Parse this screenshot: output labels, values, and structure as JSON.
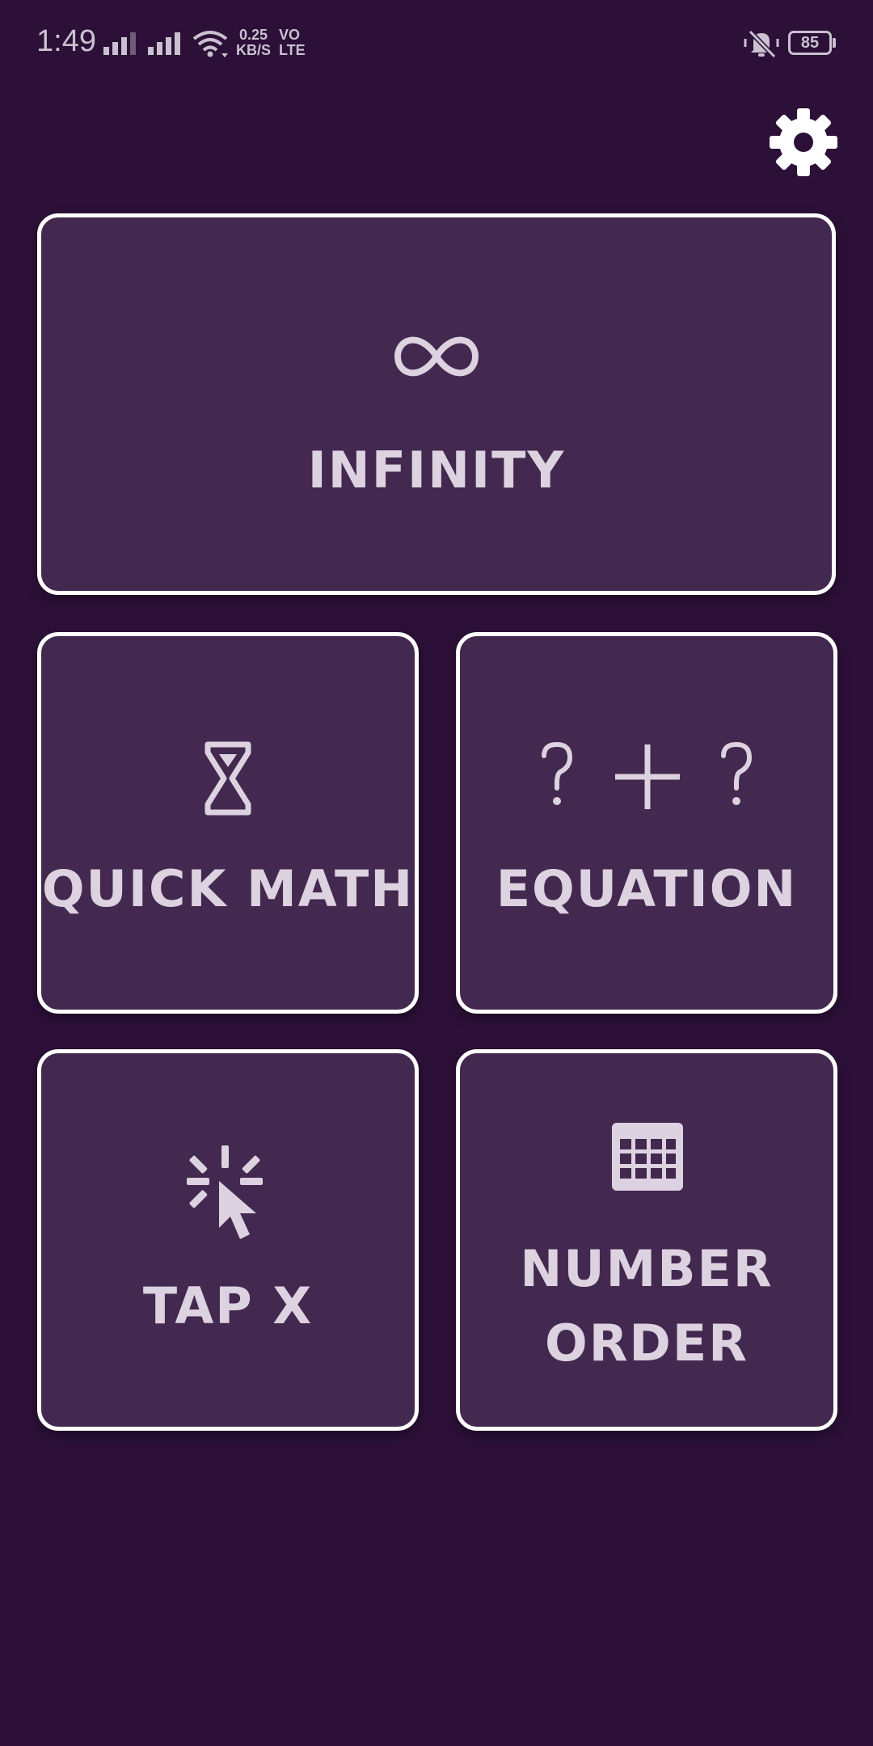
{
  "status_bar": {
    "time": "1:49",
    "net_speed_value": "0.25",
    "net_speed_unit": "KB/S",
    "volte_top": "VO",
    "volte_bottom": "LTE",
    "battery": "85",
    "icons": [
      "signal-icon",
      "signal-icon",
      "wifi-icon",
      "mute-icon",
      "battery-icon"
    ]
  },
  "header": {
    "settings_icon": "gear-icon"
  },
  "modes": {
    "infinity": {
      "label": "INFINITY",
      "icon": "infinity-icon"
    },
    "quick_math": {
      "label": "QUICK MATH",
      "icon": "hourglass-icon"
    },
    "equation": {
      "label": "EQUATION",
      "icon": "question-plus-question-icon"
    },
    "tap_x": {
      "label": "TAP X",
      "icon": "tap-cursor-icon"
    },
    "number_order": {
      "label_line1": "NUMBER",
      "label_line2": "ORDER",
      "icon": "grid-icon"
    }
  },
  "colors": {
    "background": "#2c1038",
    "card": "#432850",
    "card_border": "#ffffff",
    "text": "#dcd2e0"
  }
}
